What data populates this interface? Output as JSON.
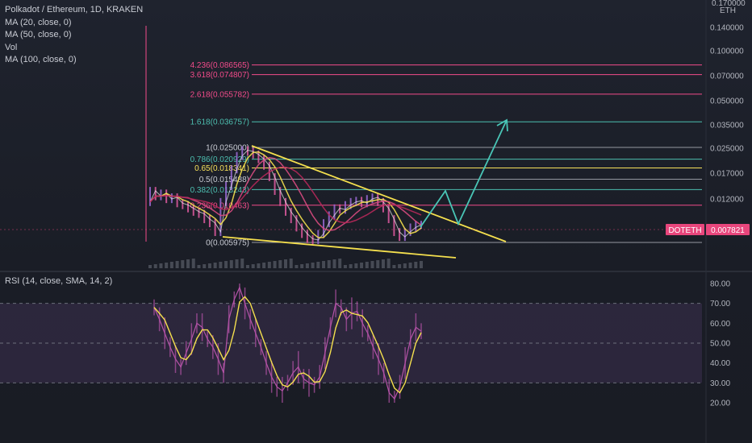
{
  "header": {
    "title": "Polkadot / Ethereum, 1D, KRAKEN",
    "indicators": [
      "MA (20, close, 0)",
      "MA (50, close, 0)",
      "Vol",
      "MA (100, close, 0)"
    ]
  },
  "rsi_panel": {
    "title": "RSI (14, close, SMA, 14, 2)"
  },
  "price_axis": {
    "unit": "ETH",
    "top_label": "0.170000",
    "ticks": [
      "0.140000",
      "0.100000",
      "0.070000",
      "0.050000",
      "0.035000",
      "0.025000",
      "0.017000",
      "0.012000"
    ]
  },
  "rsi_axis": {
    "ticks": [
      "80.00",
      "70.00",
      "60.00",
      "50.00",
      "40.00",
      "30.00",
      "20.00"
    ]
  },
  "price_tag": {
    "symbol": "DOTETH",
    "value": "0.007821",
    "colors": {
      "bg": "#e8467c",
      "text": "#ffffff"
    }
  },
  "colors": {
    "fib_pink": "#f24b8a",
    "fib_teal": "#4dbfb0",
    "fib_yellow": "#f7e05a",
    "fib_gray": "#9598a1",
    "trendline": "#f5e04e",
    "arrow": "#49c5b6",
    "candle_pink": "#e05aa0",
    "candle_purple": "#9b6ad6",
    "ma_yellow": "#f5e04e",
    "ma_red": "#b8285a",
    "ma_pink": "#d84a80",
    "rsi_line": "#b553a8",
    "rsi_sma": "#f5e04e",
    "rsi_band": "#3d3050"
  },
  "chart_data": {
    "type": "line",
    "title": "Polkadot / Ethereum, 1D, KRAKEN",
    "y_scale": "log",
    "fib_levels": [
      {
        "label": "4.236(0.086565)",
        "value": 0.086565,
        "color": "pink"
      },
      {
        "label": "3.618(0.074807)",
        "value": 0.074807,
        "color": "pink"
      },
      {
        "label": "2.618(0.055782)",
        "value": 0.055782,
        "color": "pink"
      },
      {
        "label": "1.618(0.036757)",
        "value": 0.036757,
        "color": "teal"
      },
      {
        "label": "1(0.025000)",
        "value": 0.025,
        "color": "gray"
      },
      {
        "label": "0.786(0.020929)",
        "value": 0.020929,
        "color": "teal"
      },
      {
        "label": "0.65(0.018341)",
        "value": 0.018341,
        "color": "yellow"
      },
      {
        "label": "0.5(0.015488)",
        "value": 0.015488,
        "color": "gray"
      },
      {
        "label": "0.382(0.013243)",
        "value": 0.013243,
        "color": "teal"
      },
      {
        "label": "0.236(0.010463)",
        "value": 0.010463,
        "color": "pink"
      },
      {
        "label": "0(0.005975)",
        "value": 0.005975,
        "color": "gray"
      }
    ],
    "price_series": [
      0.011,
      0.013,
      0.012,
      0.0125,
      0.0115,
      0.0118,
      0.0108,
      0.0105,
      0.01,
      0.0095,
      0.0092,
      0.0085,
      0.008,
      0.007,
      0.011,
      0.014,
      0.018,
      0.022,
      0.024,
      0.0235,
      0.0225,
      0.021,
      0.019,
      0.016,
      0.013,
      0.011,
      0.0095,
      0.0085,
      0.0075,
      0.0068,
      0.0063,
      0.0062,
      0.0068,
      0.008,
      0.009,
      0.01,
      0.0098,
      0.0105,
      0.011,
      0.0112,
      0.0108,
      0.0115,
      0.0118,
      0.011,
      0.01,
      0.0085,
      0.007,
      0.0065,
      0.007,
      0.0075,
      0.0078
    ],
    "rsi_series": [
      68,
      62,
      55,
      48,
      42,
      38,
      45,
      52,
      60,
      58,
      52,
      48,
      42,
      35,
      62,
      72,
      78,
      70,
      62,
      55,
      48,
      40,
      33,
      28,
      26,
      30,
      35,
      38,
      32,
      30,
      29,
      33,
      45,
      58,
      70,
      68,
      62,
      65,
      66,
      60,
      55,
      48,
      42,
      35,
      25,
      22,
      28,
      40,
      52,
      58,
      56
    ],
    "rsi_range": [
      20,
      80
    ],
    "rsi_bands": [
      30,
      50,
      70
    ]
  }
}
